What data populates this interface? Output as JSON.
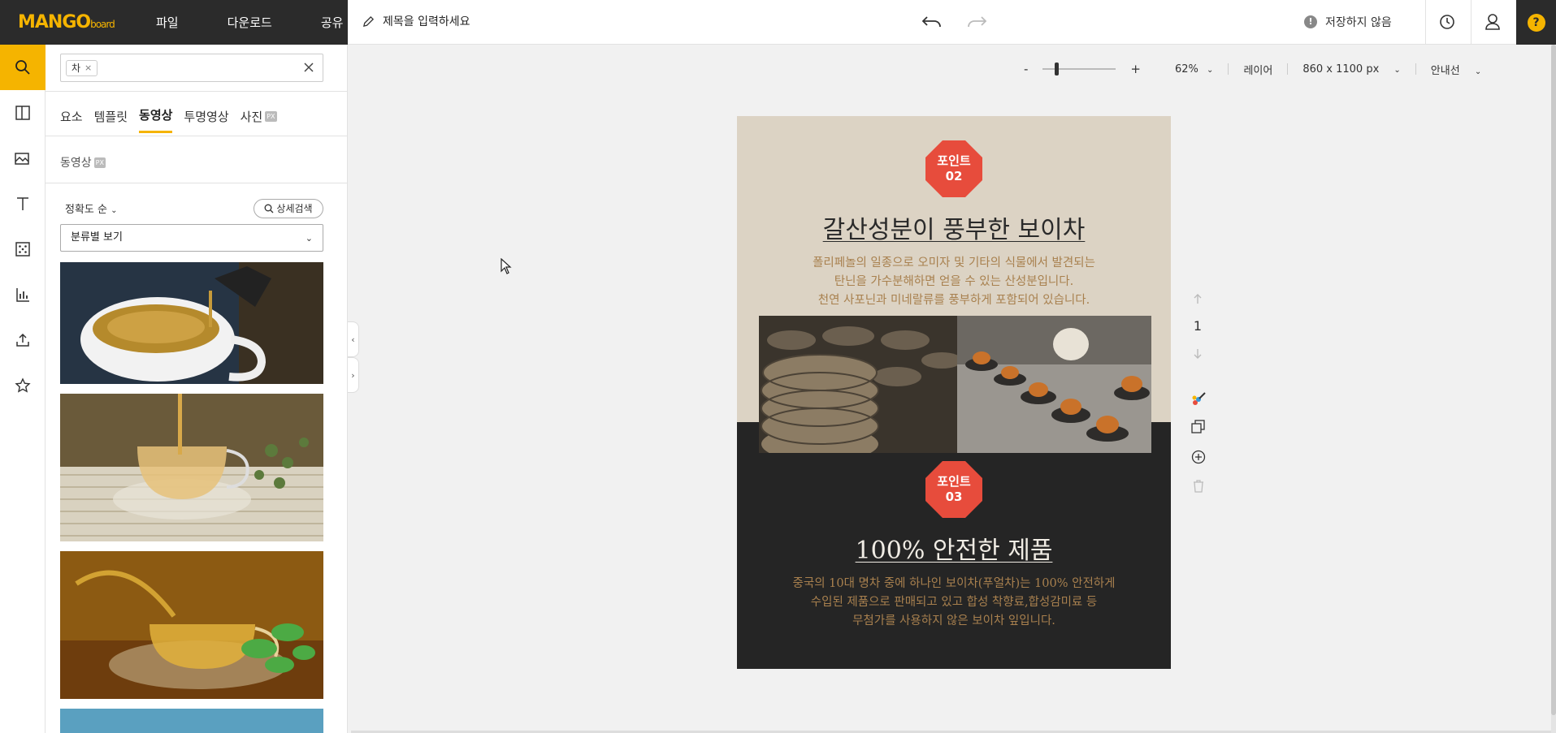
{
  "app": {
    "logo_text": "MANGO",
    "logo_small": "board",
    "menu": [
      "파일",
      "다운로드",
      "공유"
    ],
    "title_placeholder": "제목을 입력하세요",
    "save_status": "저장하지 않음",
    "help_label": "?"
  },
  "search": {
    "chip_label": "차",
    "chip_remove": "×",
    "tabs": [
      "요소",
      "템플릿",
      "동영상",
      "투명영상",
      "사진"
    ],
    "active_tab": "동영상",
    "badge": "PX",
    "subtitle": "동영상",
    "sort_label": "정확도 순",
    "advanced_search": "상세검색",
    "category_select": "분류별 보기"
  },
  "workspace": {
    "zoom_minus": "-",
    "zoom_plus": "+",
    "zoom_level": "62%",
    "layers_label": "레이어",
    "canvas_size": "860 x 1100 px",
    "guides_label": "안내선",
    "page_number": "1",
    "zoom_fraction": 0.2
  },
  "design": {
    "badge1_top": "포인트",
    "badge1_num": "02",
    "heading1": "갈산성분이 풍부한 보이차",
    "para1_line1": "폴리페놀의 일종으로 오미자 및 기타의 식물에서 발견되는",
    "para1_line2": "탄닌을 가수분해하면 얻을 수 있는 산성분입니다.",
    "para1_line3": "천연 사포닌과 미네랄류를 풍부하게 포함되어 있습니다.",
    "badge2_top": "포인트",
    "badge2_num": "03",
    "heading2": "100% 안전한 제품",
    "para2_line1": "중국의 10대 명차 중에 하나인 보이차(푸얼차)는 100% 안전하게",
    "para2_line2": "수입된 제품으로 판매되고 있고 합성 착향료,합성감미료 등",
    "para2_line3": "무첨가를 사용하지 않은 보이차 잎입니다."
  },
  "colors": {
    "accent": "#f5b400",
    "dark_header": "#2b2b2b",
    "badge_red": "#e74c3c",
    "text_brown": "#a8804e",
    "canvas_beige": "#dcd3c4",
    "canvas_dark": "#252525"
  }
}
